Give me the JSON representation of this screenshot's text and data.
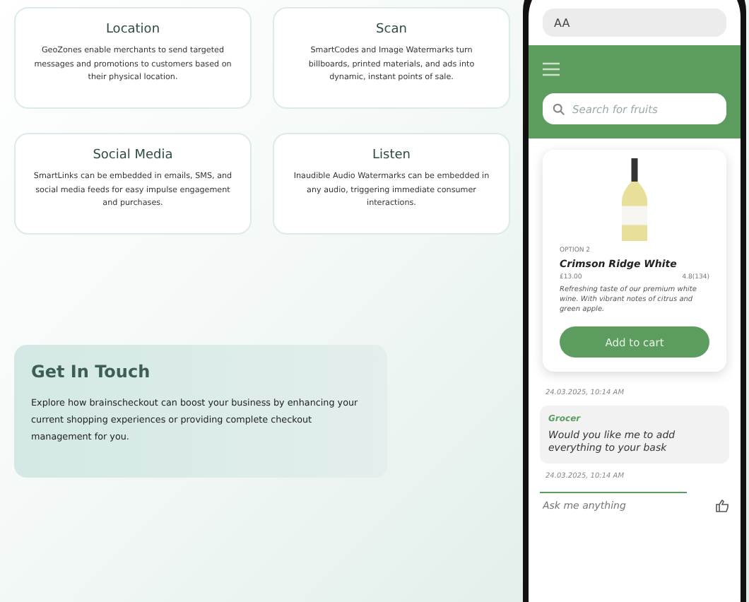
{
  "features": [
    {
      "title": "Location",
      "text": "GeoZones enable merchants to send targeted messages and promotions to customers based on their physical location."
    },
    {
      "title": "Scan",
      "text": "SmartCodes and Image Watermarks turn billboards, printed materials, and ads into dynamic, instant points of sale."
    },
    {
      "title": "Social Media",
      "text": "SmartLinks can be embedded in emails, SMS, and social media feeds for easy impulse engagement and purchases."
    },
    {
      "title": "Listen",
      "text": "Inaudible Audio Watermarks can be embedded in any audio, triggering immediate consumer interactions."
    }
  ],
  "contact": {
    "title": "Get In Touch",
    "text": "Explore how brainscheckout can boost your business by enhancing your current shopping experiences or providing complete checkout management for you."
  },
  "phone": {
    "address": "AA",
    "search": {
      "placeholder": "Search for fruits"
    },
    "product": {
      "option": "OPTION 2",
      "name": "Crimson Ridge White",
      "price": "£13.00",
      "rating": "4.8(134)",
      "description": "Refreshing taste of our premium white wine. With vibrant notes of citrus and green apple.",
      "button": "Add to cart"
    },
    "messages": [
      {
        "time": "24.03.2025, 10:14 AM",
        "sender": "Grocer",
        "text": "Would you like me to add everything to your bask"
      }
    ],
    "last_time": "24.03.2025, 10:14 AM",
    "input": {
      "placeholder": "Ask me anything"
    }
  }
}
